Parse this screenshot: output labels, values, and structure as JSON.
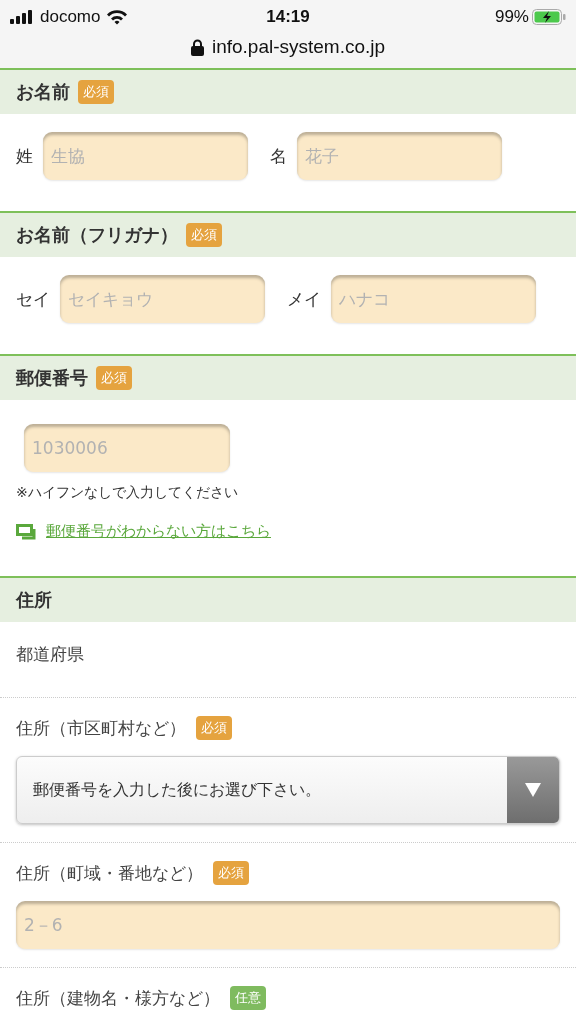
{
  "status_bar": {
    "carrier": "docomo",
    "time": "14:19",
    "battery": "99%",
    "url": "info.pal-system.co.jp"
  },
  "sections": [
    {
      "kind": "pair",
      "title": "お名前",
      "badge": {
        "label": "必須",
        "kind": "required"
      },
      "fields": [
        {
          "label": "姓",
          "placeholder": "生協"
        },
        {
          "label": "名",
          "placeholder": "花子"
        }
      ]
    },
    {
      "kind": "pair",
      "title": "お名前（フリガナ）",
      "badge": {
        "label": "必須",
        "kind": "required"
      },
      "fields": [
        {
          "label": "セイ",
          "placeholder": "セイキョウ"
        },
        {
          "label": "メイ",
          "placeholder": "ハナコ"
        }
      ]
    },
    {
      "kind": "postal",
      "title": "郵便番号",
      "badge": {
        "label": "必須",
        "kind": "required"
      },
      "placeholder": "1030006",
      "note": "※ハイフンなしで入力してください",
      "link": "郵便番号がわからない方はこちら"
    },
    {
      "kind": "address",
      "title": "住所",
      "items": [
        {
          "kind": "plain",
          "label": "都道府県"
        },
        {
          "kind": "select",
          "label": "住所（市区町村など）",
          "badge": {
            "label": "必須",
            "kind": "required"
          },
          "value": "郵便番号を入力した後にお選び下さい。"
        },
        {
          "kind": "input",
          "label": "住所（町域・番地など）",
          "badge": {
            "label": "必須",
            "kind": "required"
          },
          "placeholder": "2－6"
        },
        {
          "kind": "plain",
          "label": "住所（建物名・様方など）",
          "badge": {
            "label": "任意",
            "kind": "optional"
          }
        }
      ]
    }
  ]
}
